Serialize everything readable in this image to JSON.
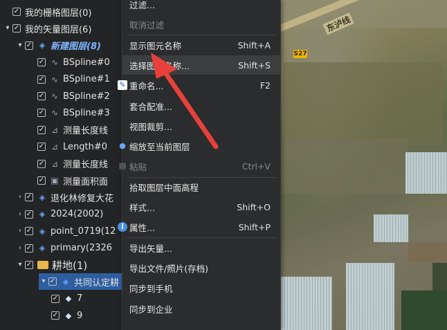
{
  "tree": {
    "items": [
      {
        "label": "我的栅格图层(0)",
        "expand": "",
        "check": "✓",
        "icon": "",
        "indent": 0
      },
      {
        "label": "我的矢量图层(6)",
        "expand": "▾",
        "check": "✓",
        "icon": "",
        "indent": 0
      },
      {
        "label": "新建图层(8)",
        "expand": "▾",
        "check": "✓",
        "icon": "layers",
        "indent": 1
      },
      {
        "label": "BSpline#0",
        "expand": "",
        "check": "✓",
        "icon": "spline",
        "indent": 2
      },
      {
        "label": "BSpline#1",
        "expand": "",
        "check": "✓",
        "icon": "spline",
        "indent": 2
      },
      {
        "label": "BSpline#2",
        "expand": "",
        "check": "✓",
        "icon": "spline",
        "indent": 2
      },
      {
        "label": "BSpline#3",
        "expand": "",
        "check": "✓",
        "icon": "spline",
        "indent": 2
      },
      {
        "label": "测量长度线",
        "expand": "",
        "check": "✓",
        "icon": "measure",
        "indent": 2
      },
      {
        "label": "Length#0",
        "expand": "",
        "check": "✓",
        "icon": "measure",
        "indent": 2
      },
      {
        "label": "测量长度线",
        "expand": "",
        "check": "✓",
        "icon": "measure",
        "indent": 2
      },
      {
        "label": "测量面积面",
        "expand": "",
        "check": "✓",
        "icon": "area",
        "indent": 2
      },
      {
        "label": "退化林修复大花",
        "expand": "›",
        "check": "✓",
        "icon": "layers",
        "indent": 1
      },
      {
        "label": "2024(2002)",
        "expand": "›",
        "check": "✓",
        "icon": "layers",
        "indent": 1
      },
      {
        "label": "point_0719(12",
        "expand": "›",
        "check": "✓",
        "icon": "layers",
        "indent": 1
      },
      {
        "label": "primary(2326",
        "expand": "›",
        "check": "✓",
        "icon": "layers",
        "indent": 1
      },
      {
        "label": "耕地(1)",
        "expand": "▾",
        "check": "✓",
        "icon": "folder",
        "indent": 1
      },
      {
        "label": "共同认定耕",
        "expand": "▾",
        "check": "✓",
        "icon": "layers",
        "indent": 2
      },
      {
        "label": "7",
        "expand": "",
        "check": "✓",
        "icon": "shape",
        "indent": 3
      },
      {
        "label": "9",
        "expand": "",
        "check": "✓",
        "icon": "shape",
        "indent": 3
      }
    ]
  },
  "menu": {
    "items": [
      {
        "label": "过滤...",
        "shortcut": "",
        "disabled": false,
        "icon": ""
      },
      {
        "label": "取消过滤",
        "shortcut": "",
        "disabled": true,
        "icon": ""
      },
      {
        "label": "显示图元名称",
        "shortcut": "Shift+A",
        "disabled": false,
        "icon": ""
      },
      {
        "label": "选择图元名称...",
        "shortcut": "Shift+S",
        "disabled": false,
        "icon": ""
      },
      {
        "label": "重命名...",
        "shortcut": "F2",
        "disabled": false,
        "icon": "edit"
      },
      {
        "label": "套合配准...",
        "shortcut": "",
        "disabled": false,
        "icon": ""
      },
      {
        "label": "视图裁剪...",
        "shortcut": "",
        "disabled": false,
        "icon": ""
      },
      {
        "label": "缩放至当前图层",
        "shortcut": "",
        "disabled": false,
        "icon": "person"
      },
      {
        "label": "粘贴",
        "shortcut": "Ctrl+V",
        "disabled": true,
        "icon": "paste"
      },
      {
        "label": "拾取图层中面高程",
        "shortcut": "",
        "disabled": false,
        "icon": ""
      },
      {
        "label": "样式...",
        "shortcut": "Shift+O",
        "disabled": false,
        "icon": ""
      },
      {
        "label": "属性...",
        "shortcut": "Shift+P",
        "disabled": false,
        "icon": "info"
      },
      {
        "label": "导出矢量...",
        "shortcut": "",
        "disabled": false,
        "icon": ""
      },
      {
        "label": "导出文件/照片(存档)",
        "shortcut": "",
        "disabled": false,
        "icon": ""
      },
      {
        "label": "同步到手机",
        "shortcut": "",
        "disabled": false,
        "icon": ""
      },
      {
        "label": "同步到企业",
        "shortcut": "",
        "disabled": false,
        "icon": ""
      }
    ]
  },
  "map": {
    "road_name": "东泸线",
    "road_badge": "S27"
  },
  "colors": {
    "accent": "#2e5ea0",
    "arrow": "#e8403a",
    "highlight": "#f0e65a"
  }
}
